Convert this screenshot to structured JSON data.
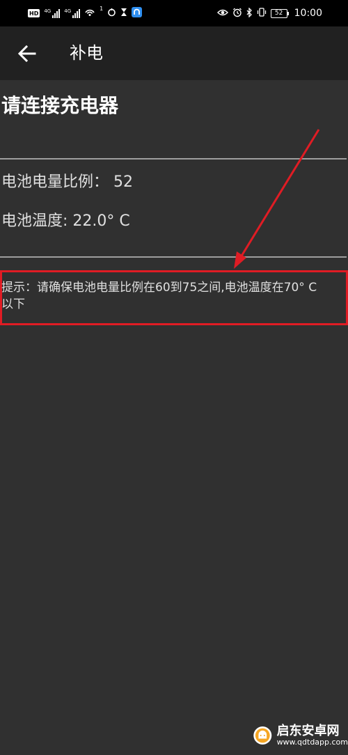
{
  "status_bar": {
    "hd_label": "HD",
    "signal1_label": "4G",
    "signal2_label": "4G",
    "wifi_sup": "1",
    "battery": "52",
    "time": "10:00"
  },
  "app_bar": {
    "back_icon": "arrow-left-icon",
    "title": "补电"
  },
  "content": {
    "heading": "请连接充电器",
    "battery_level": "电池电量比例： 52",
    "battery_temp": "电池温度: 22.0° C",
    "hint": "提示：请确保电池电量比例在60到75之间,电池温度在70° C以下"
  },
  "annotation": {
    "color": "#e01c24"
  },
  "watermark": {
    "name": "启东安卓网",
    "url": "www.qdtdapp.com"
  }
}
